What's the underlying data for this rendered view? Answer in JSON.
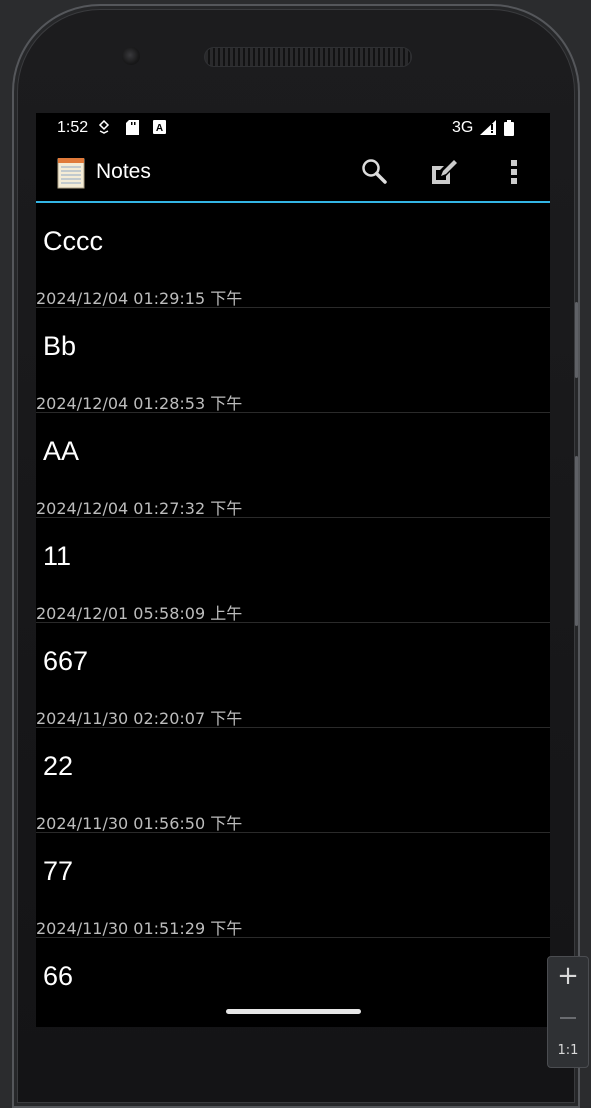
{
  "status_bar": {
    "time": "1:52",
    "network": "3G"
  },
  "action_bar": {
    "title": "Notes",
    "icons": [
      "notepad-icon",
      "search-icon",
      "new-note-icon",
      "overflow-menu-icon"
    ]
  },
  "notes": [
    {
      "title": "Cccc",
      "date": "2024/12/04 01:29:15 下午"
    },
    {
      "title": "Bb",
      "date": "2024/12/04 01:28:53 下午"
    },
    {
      "title": "AA",
      "date": "2024/12/04 01:27:32 下午"
    },
    {
      "title": "11",
      "date": "2024/12/01 05:58:09 上午"
    },
    {
      "title": "667",
      "date": "2024/11/30 02:20:07 下午"
    },
    {
      "title": "22",
      "date": "2024/11/30 01:56:50 下午"
    },
    {
      "title": "77",
      "date": "2024/11/30 01:51:29 下午"
    },
    {
      "title": "66",
      "date": ""
    }
  ],
  "zoom": {
    "plus": "+",
    "ratio": "1:1"
  },
  "colors": {
    "accent": "#33b5e5",
    "background": "#000000",
    "divider": "#2a2a2a"
  }
}
